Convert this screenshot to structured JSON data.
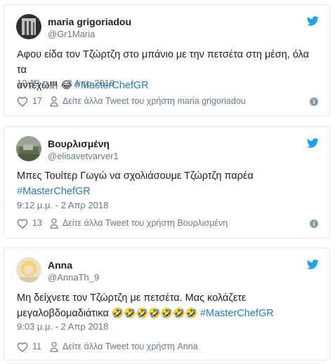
{
  "tweets": [
    {
      "name": "maria grigoriadou",
      "handle": "@Gr1Maria",
      "text_line1": "Αφου είδα τον Τζώρτζη στο μπάνιο με την πετσέτα στη μέση, όλα τα",
      "text_line2": "αντέχω!!!",
      "emojis": "😂",
      "hashtag": "#MasterChefGR",
      "time": "12:19 π.μ. - 3 Απρ 2018",
      "likes": "17",
      "more_link": "Δείτε άλλα Tweet του χρήστη maria grigoriadou"
    },
    {
      "name": "Βουρλισμένη",
      "handle": "@elisavetvarver1",
      "text_line1": "Μπες Τουίτερ Γωγώ να σχολιάσουμε Τζώρτζη παρέα",
      "hashtag": "#MasterChefGR",
      "time": "9:12 μ.μ. - 2 Απρ 2018",
      "likes": "13",
      "more_link": "Δείτε άλλα Tweet του χρήστη Βουρλισμένη"
    },
    {
      "name": "Anna",
      "handle": "@AnnaTh_9",
      "text_line1": "Μη δείχνετε τον Τζώρτζη με πετσέτα. Μας κολάζετε",
      "text_line2": "μεγαλοβδομαδιάτικα",
      "emojis": "🤣🤣🤣🤣🤣🤣🤣",
      "hashtag": "#MasterChefGR",
      "time": "9:03 μ.μ. - 2 Απρ 2018",
      "likes": "11",
      "more_link": "Δείτε άλλα Tweet του χρήστη Anna"
    }
  ],
  "icons": {
    "brand": "twitter-bird-icon",
    "like": "heart-icon",
    "profile": "person-icon",
    "info": "info-icon",
    "info_glyph": "i"
  },
  "colors": {
    "twitter_blue": "#1da1f2",
    "hashtag": "#2b7bb9",
    "muted": "#697882",
    "border": "#e1e8ed"
  }
}
